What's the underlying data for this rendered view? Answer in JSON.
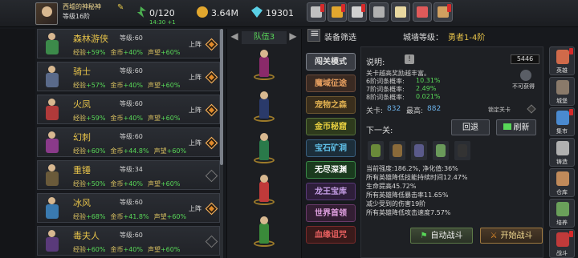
{
  "player": {
    "name": "西墟的神秘神",
    "level_text": "等级16阶"
  },
  "resources": {
    "energy": "0/120",
    "gold": "3.64M",
    "gems": "19301",
    "energy_timer": "14:30 +1"
  },
  "toolbar_buttons": [
    {
      "name": "shop-button",
      "color": "#c0c0c0",
      "badge": true
    },
    {
      "name": "mail-button",
      "color": "#e2a72e",
      "badge": true
    },
    {
      "name": "quest-button",
      "color": "#d0d0d0",
      "badge": true
    },
    {
      "name": "settings-button",
      "color": "#b0b0b0",
      "badge": false
    },
    {
      "name": "gift-button",
      "color": "#e8d8a0",
      "badge": false
    },
    {
      "name": "refresh-button",
      "color": "#e05a5a",
      "badge": false
    },
    {
      "name": "bag-button",
      "color": "#d0a060",
      "badge": true
    }
  ],
  "labels": {
    "exp": "经验",
    "gold": "金币",
    "fame": "声望",
    "level": "等级",
    "deploy": "上阵"
  },
  "heroes": [
    {
      "name": "森林游侠",
      "level": "60",
      "exp": "+59%",
      "gold": "+40%",
      "fame": "+60%",
      "deployed": true,
      "color": "#3c8a4a"
    },
    {
      "name": "骑士",
      "level": "60",
      "exp": "+57%",
      "gold": "+40%",
      "fame": "+60%",
      "deployed": true,
      "color": "#5a6a8a"
    },
    {
      "name": "火凤",
      "level": "60",
      "exp": "+59%",
      "gold": "+40%",
      "fame": "+60%",
      "deployed": true,
      "color": "#b03a3a"
    },
    {
      "name": "幻刺",
      "level": "60",
      "exp": "+60%",
      "gold": "+44.8%",
      "fame": "+60%",
      "deployed": true,
      "color": "#8a3a8a"
    },
    {
      "name": "重锤",
      "level": "34",
      "exp": "+50%",
      "gold": "+40%",
      "fame": "+60%",
      "deployed": false,
      "color": "#6a5a3a"
    },
    {
      "name": "冰风",
      "level": "60",
      "exp": "+68%",
      "gold": "+41.8%",
      "fame": "+60%",
      "deployed": true,
      "color": "#3a7ab0"
    },
    {
      "name": "毒夫人",
      "level": "60",
      "exp": "+60%",
      "gold": "+40%",
      "fame": "+60%",
      "deployed": false,
      "color": "#5a3a7a"
    }
  ],
  "team": {
    "title": "队伍3",
    "member_colors": [
      "#8a2a6a",
      "#2a3a6a",
      "#2a7a4a",
      "#c03a3a",
      "#3a8a3a"
    ]
  },
  "header": {
    "filter": "装备筛选",
    "castle_label": "城墙等级：",
    "castle_value": "勇者1-4阶"
  },
  "modes": [
    {
      "label": "闯关模式",
      "bg": "#3a3d44",
      "border": "#7a7f88",
      "color": "#e0e0e0"
    },
    {
      "label": "魔域征途",
      "bg": "#3a2a22",
      "border": "#6a4a3a",
      "color": "#e8a060"
    },
    {
      "label": "宠物之森",
      "bg": "#3a2e1c",
      "border": "#6a5530",
      "color": "#e0b050"
    },
    {
      "label": "金币秘窟",
      "bg": "#2e3a1c",
      "border": "#55703a",
      "color": "#e8d040"
    },
    {
      "label": "宝石矿洞",
      "bg": "#1c2e3a",
      "border": "#3a6080",
      "color": "#60c0e8"
    },
    {
      "label": "无尽深渊",
      "bg": "#1a3a1e",
      "border": "#3a8a48",
      "color": "#ffffff"
    },
    {
      "label": "龙王宝库",
      "bg": "#2e1e3a",
      "border": "#5a3a7a",
      "color": "#c8a0e8"
    },
    {
      "label": "世界首领",
      "bg": "#331e33",
      "border": "#6a3a6a",
      "color": "#e0a0e0"
    },
    {
      "label": "血缘诅咒",
      "bg": "#3a1a1a",
      "border": "#7a2a2a",
      "color": "#e86060"
    }
  ],
  "info": {
    "title": "说明:",
    "ticket": "5446",
    "desc": "关卡越高奖励越丰富。",
    "drop6_label": "6阶词条概率:",
    "drop6": "10.31%",
    "drop7_label": "7阶词条概率:",
    "drop7": "2.49%",
    "drop8_label": "8阶词条概率:",
    "drop8": "0.021%",
    "unobtainable": "不可获得",
    "stage_label": "关卡:",
    "stage": "832",
    "best_label": "最高:",
    "best": "882",
    "lock_label": "锁定关卡",
    "next_label": "下一关:",
    "retreat": "回退",
    "refresh": "刷新",
    "monster_colors": [
      "#6a8a3a",
      "#8a6a3a",
      "#5a5a8a",
      "#6a9a5a",
      "#333333"
    ],
    "stats": [
      "当前强度:186.2%, 净化值:36%",
      "所有英雄降低技能持续时间12.47%",
      "生命提高45.72%",
      "所有英雄降低暴击率11.65%",
      "减少受到的伤害19阶",
      "所有英雄降低攻击速度7.57%"
    ]
  },
  "actions": {
    "auto_battle": "自动战斗",
    "start_battle": "开始战斗"
  },
  "sidebar": [
    {
      "label": "英雄",
      "color": "#d06a4a",
      "badge": true
    },
    {
      "label": "城堡",
      "color": "#8a7a6a",
      "badge": false
    },
    {
      "label": "集市",
      "color": "#4a8ad0",
      "badge": true
    },
    {
      "label": "铸造",
      "color": "#b0b0b0",
      "badge": false
    },
    {
      "label": "仓库",
      "color": "#c08a5a",
      "badge": false
    },
    {
      "label": "培养",
      "color": "#6aa05a",
      "badge": false
    },
    {
      "label": "战斗",
      "color": "#c03a3a",
      "badge": true
    }
  ]
}
